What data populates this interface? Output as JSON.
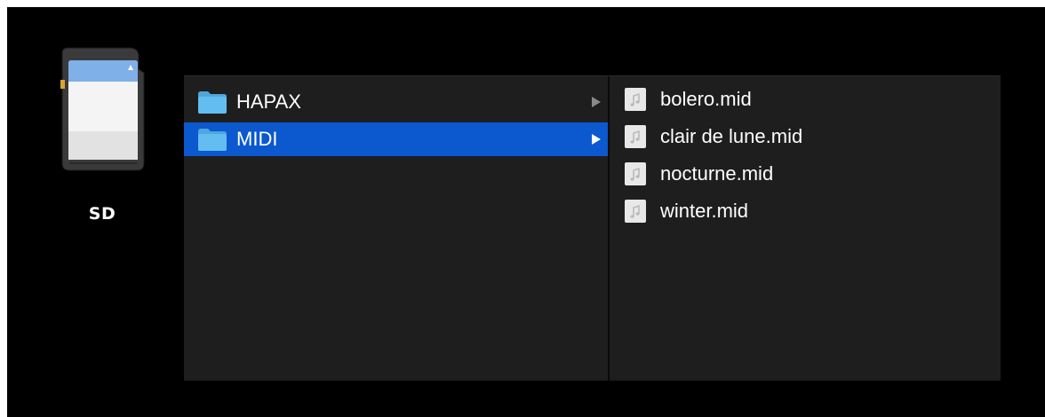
{
  "device": {
    "label": "SD",
    "icon": "sd-card-icon"
  },
  "columns": {
    "folders": [
      {
        "label": "HAPAX",
        "icon": "folder-icon",
        "selected": false
      },
      {
        "label": "MIDI",
        "icon": "folder-icon",
        "selected": true
      }
    ],
    "files": [
      {
        "label": "bolero.mid",
        "icon": "midi-file-icon"
      },
      {
        "label": "clair de lune.mid",
        "icon": "midi-file-icon"
      },
      {
        "label": "nocturne.mid",
        "icon": "midi-file-icon"
      },
      {
        "label": "winter.mid",
        "icon": "midi-file-icon"
      }
    ]
  },
  "colors": {
    "background": "#000000",
    "column_background": "#1e1e1e",
    "selection": "#0b58cf",
    "folder_blue": "#5ab4ea",
    "text": "#ffffff"
  }
}
